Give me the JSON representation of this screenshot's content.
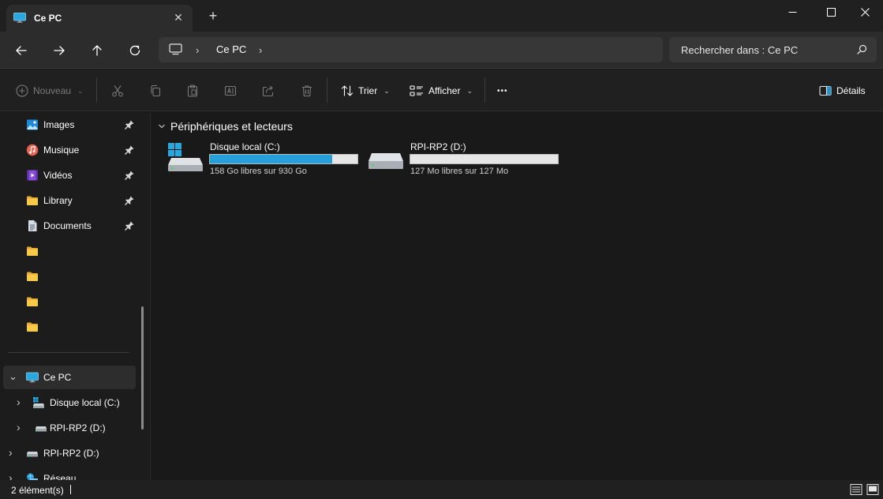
{
  "window": {
    "tab_title": "Ce PC",
    "tab_close_glyph": "✕",
    "new_tab_glyph": "+"
  },
  "address": {
    "chevron": "›",
    "location": "Ce PC",
    "search_placeholder": "Rechercher dans : Ce PC"
  },
  "commands": {
    "new_label": "Nouveau",
    "sort_label": "Trier",
    "view_label": "Afficher",
    "more_glyph": "•••",
    "details_label": "Détails",
    "chevron_down": "⌄"
  },
  "sidebar": {
    "chevron_right": "›",
    "chevron_down": "⌄",
    "quick_access": [
      {
        "label": "Images",
        "icon": "images-icon",
        "pinned": true
      },
      {
        "label": "Musique",
        "icon": "music-icon",
        "pinned": true
      },
      {
        "label": "Vidéos",
        "icon": "videos-icon",
        "pinned": true
      },
      {
        "label": "Library",
        "icon": "folder-icon",
        "pinned": true
      },
      {
        "label": "Documents",
        "icon": "documents-icon",
        "pinned": true
      },
      {
        "label": "",
        "icon": "folder-icon",
        "pinned": false
      },
      {
        "label": "",
        "icon": "folder-icon",
        "pinned": false
      },
      {
        "label": "",
        "icon": "folder-icon",
        "pinned": false
      },
      {
        "label": "",
        "icon": "folder-icon",
        "pinned": false
      }
    ],
    "tree": {
      "this_pc": "Ce PC",
      "local_disk": "Disque local (C:)",
      "rpi_child": "RPI-RP2 (D:)",
      "rpi_root": "RPI-RP2 (D:)",
      "network": "Réseau"
    }
  },
  "main": {
    "section_title": "Périphériques et lecteurs",
    "drives": [
      {
        "name": "Disque local (C:)",
        "free_text": "158 Go libres sur 930 Go",
        "used_fraction": 0.83,
        "bar_color": "#26a0da",
        "icon": "windows-drive-icon"
      },
      {
        "name": "RPI-RP2 (D:)",
        "free_text": "127 Mo libres sur 127 Mo",
        "used_fraction": 0.0,
        "bar_color": "#26a0da",
        "icon": "usb-drive-icon"
      }
    ]
  },
  "status": {
    "item_count": "2 élément(s)"
  },
  "colors": {
    "accent": "#26a0da",
    "folder": "#f4c542"
  }
}
